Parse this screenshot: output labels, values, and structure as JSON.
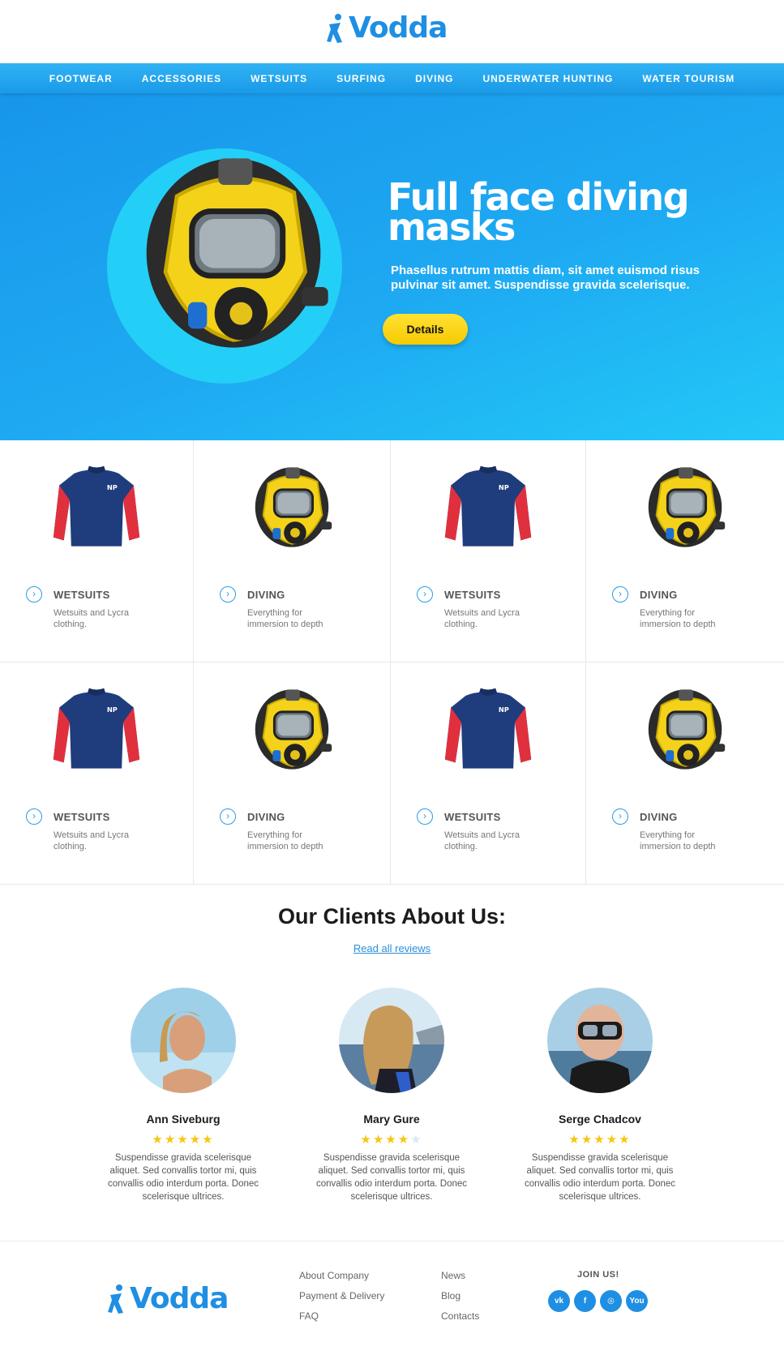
{
  "brand": {
    "name": "Vodda",
    "color": "#1e8fe3"
  },
  "nav": {
    "items": [
      "FOOTWEAR",
      "ACCESSORIES",
      "WETSUITS",
      "SURFING",
      "DIVING",
      "UNDERWATER HUNTING",
      "WATER TOURISM"
    ]
  },
  "hero": {
    "title": "Full face diving masks",
    "text": "Phasellus rutrum mattis diam, sit amet euismod risus pulvinar sit amet. Suspendisse gravida scelerisque.",
    "button": "Details"
  },
  "products": [
    {
      "title": "WETSUITS",
      "desc": "Wetsuits and Lycra clothing.",
      "icon": "wetsuit"
    },
    {
      "title": "DIVING",
      "desc": "Everything for immersion to depth",
      "icon": "diving-mask"
    },
    {
      "title": "WETSUITS",
      "desc": "Wetsuits and Lycra clothing.",
      "icon": "wetsuit"
    },
    {
      "title": "DIVING",
      "desc": "Everything for immersion to depth",
      "icon": "diving-mask"
    },
    {
      "title": "WETSUITS",
      "desc": "Wetsuits and Lycra clothing.",
      "icon": "wetsuit"
    },
    {
      "title": "DIVING",
      "desc": "Everything for immersion to depth",
      "icon": "diving-mask"
    },
    {
      "title": "WETSUITS",
      "desc": "Wetsuits and Lycra clothing.",
      "icon": "wetsuit"
    },
    {
      "title": "DIVING",
      "desc": "Everything for immersion to depth",
      "icon": "diving-mask"
    }
  ],
  "reviews": {
    "title": "Our Clients About Us:",
    "link": "Read all reviews",
    "items": [
      {
        "name": "Ann Siveburg",
        "rating": 5,
        "text": "Suspendisse gravida scelerisque aliquet. Sed convallis tortor mi, quis convallis odio interdum porta. Donec scelerisque ultrices."
      },
      {
        "name": "Mary Gure",
        "rating": 4,
        "text": "Suspendisse gravida scelerisque aliquet. Sed convallis tortor mi, quis convallis odio interdum porta. Donec scelerisque ultrices."
      },
      {
        "name": "Serge Chadcov",
        "rating": 5,
        "text": "Suspendisse gravida scelerisque aliquet. Sed convallis tortor mi, quis convallis odio interdum porta. Donec scelerisque ultrices."
      }
    ]
  },
  "footer": {
    "col1": [
      "About Company",
      "Payment & Delivery",
      "FAQ"
    ],
    "col2": [
      "News",
      "Blog",
      "Contacts"
    ],
    "join": "JOIN US!",
    "socials": [
      {
        "icon": "vk-icon",
        "label": "vk"
      },
      {
        "icon": "facebook-icon",
        "label": "f"
      },
      {
        "icon": "instagram-icon",
        "label": "◎"
      },
      {
        "icon": "youtube-icon",
        "label": "You"
      }
    ]
  }
}
